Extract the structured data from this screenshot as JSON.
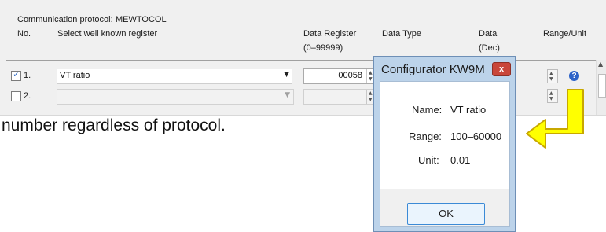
{
  "header": {
    "protocol_label": "Communication protocol:",
    "protocol_value": "MEWTOCOL",
    "col_no": "No.",
    "col_register": "Select well known register",
    "col_data_register": "Data Register",
    "col_data_register_range": "(0–99999)",
    "col_data_type": "Data Type",
    "col_data": "Data",
    "col_data_unit": "(Dec)",
    "col_range_unit": "Range/Unit"
  },
  "rows": [
    {
      "checked": true,
      "no": "1.",
      "register": "VT ratio",
      "data_register": "00058"
    },
    {
      "checked": false,
      "no": "2.",
      "register": "",
      "data_register": ""
    }
  ],
  "overlay_text": "number regardless of protocol.",
  "dialog": {
    "title": "Configurator KW9M",
    "close": "x",
    "name_label": "Name:",
    "name_value": "VT ratio",
    "range_label": "Range:",
    "range_value": "100–60000",
    "unit_label": "Unit:",
    "unit_value": "0.01",
    "ok_label": "OK"
  },
  "icons": {
    "help": "help-icon",
    "dropdown": "chevron-down-icon",
    "spin": "spin-updown-icon",
    "arrow": "pointer-arrow-icon"
  },
  "colors": {
    "arrow_fill": "#ffff00",
    "arrow_stroke": "#c8a800",
    "close_red": "#c9463a",
    "dialog_frame": "#bcd3ea"
  }
}
